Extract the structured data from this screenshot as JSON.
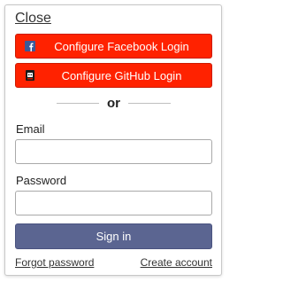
{
  "close_label": "Close",
  "social": {
    "facebook_label": "Configure Facebook Login",
    "github_label": "Configure GitHub Login",
    "facebook_icon": "facebook-icon",
    "github_icon": "github-icon",
    "button_color": "#ff2200"
  },
  "divider_text": "or",
  "email": {
    "label": "Email",
    "value": "",
    "placeholder": ""
  },
  "password": {
    "label": "Password",
    "value": "",
    "placeholder": ""
  },
  "signin_label": "Sign in",
  "signin_color": "#5b6591",
  "forgot_label": "Forgot password",
  "create_label": "Create account"
}
